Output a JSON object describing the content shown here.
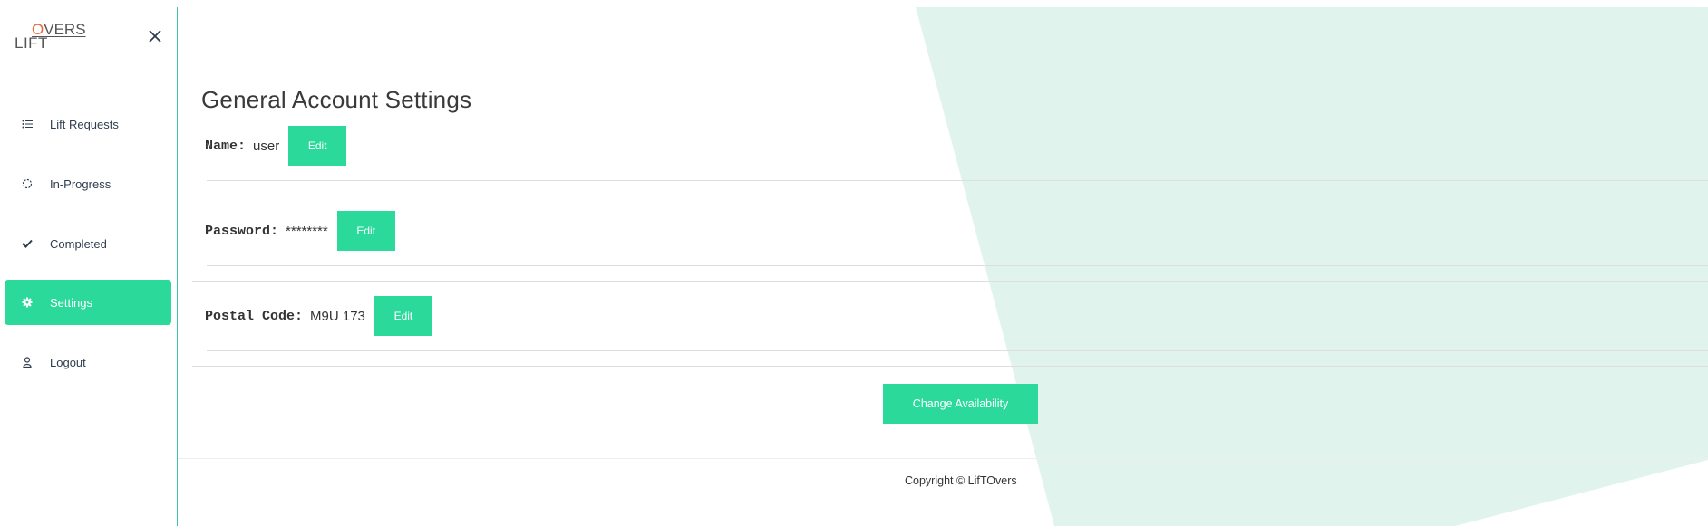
{
  "brand": {
    "logo_text_lift": "LIFT",
    "logo_text_overs_first": "O",
    "logo_text_overs_rest": "VERS"
  },
  "sidebar": {
    "items": [
      {
        "label": "Lift Requests",
        "icon": "list-icon",
        "active": false
      },
      {
        "label": "In-Progress",
        "icon": "spinner-icon",
        "active": false
      },
      {
        "label": "Completed",
        "icon": "check-icon",
        "active": false
      },
      {
        "label": "Settings",
        "icon": "gear-icon",
        "active": true
      },
      {
        "label": "Logout",
        "icon": "user-icon",
        "active": false
      }
    ]
  },
  "main": {
    "title": "General Account Settings",
    "fields": [
      {
        "label": "Name:",
        "value": "user",
        "button": "Edit"
      },
      {
        "label": "Password:",
        "value": "********",
        "button": "Edit"
      },
      {
        "label": "Postal Code:",
        "value": "M9U 173",
        "button": "Edit"
      }
    ],
    "availability_button": "Change Availability",
    "copyright": "Copyright © LifTOvers"
  },
  "colors": {
    "accent": "#2bd99a",
    "background_shape": "#e0f4ed",
    "logo_accent": "#e8693a"
  }
}
